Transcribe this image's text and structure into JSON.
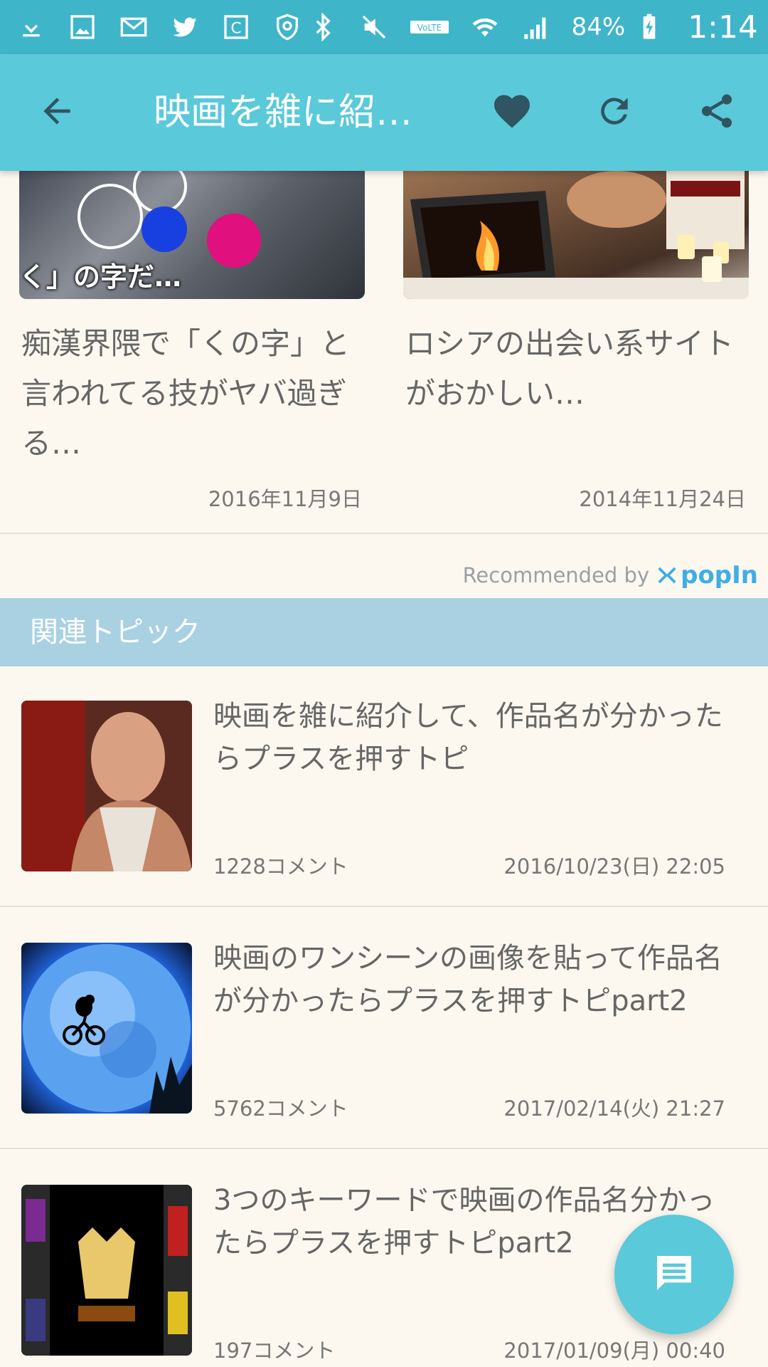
{
  "status_bar": {
    "battery_percent": "84%",
    "time": "1:14",
    "network_label": "VoLTE"
  },
  "app_bar": {
    "title": "映画を雑に紹…",
    "back_icon": "arrow-back-icon",
    "favorite_icon": "heart-icon",
    "reload_icon": "refresh-icon",
    "share_icon": "share-icon"
  },
  "cards": [
    {
      "overlay_text": "く」の字だ…",
      "title": "痴漢界隈で「くの字」と言われてる技がヤバ過ぎる…",
      "date": "2016年11月9日"
    },
    {
      "title": "ロシアの出会い系サイトがおかしい…",
      "date": "2014年11月24日"
    }
  ],
  "recommended": {
    "label": "Recommended by",
    "brand": "popIn"
  },
  "related": {
    "header": "関連トピック",
    "topics": [
      {
        "title": "映画を雑に紹介して、作品名が分かったらプラスを押すトピ",
        "comments": "1228コメント",
        "date": "2016/10/23(日) 22:05"
      },
      {
        "title": "映画のワンシーンの画像を貼って作品名が分かったらプラスを押すトピpart2",
        "comments": "5762コメント",
        "date": "2017/02/14(火) 21:27"
      },
      {
        "title": "3つのキーワードで映画の作品名分かったらプラスを押すトピpart2",
        "comments": "197コメント",
        "date": "2017/01/09(月) 00:40"
      }
    ]
  },
  "fab": {
    "icon": "comment-icon"
  },
  "colors": {
    "status_bar": "#3fb5c9",
    "app_bar": "#5ac9da",
    "section_header": "#a9d1e2",
    "background": "#fdf8ef"
  }
}
